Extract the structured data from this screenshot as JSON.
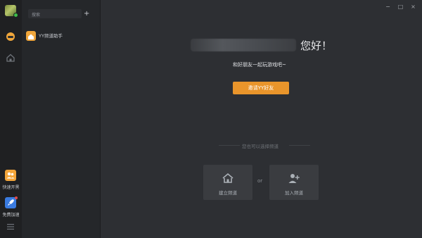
{
  "sidebar": {
    "quick_start_label": "快速开黑",
    "free_boost_label": "免费加速"
  },
  "panel": {
    "search_placeholder": "搜索",
    "add_symbol": "+",
    "channel_item": "YY频道助手"
  },
  "main": {
    "greeting": "您好！",
    "subtitle": "和好朋友一起玩游戏吧~",
    "invite_button": "邀请YY好友",
    "divider_text": "您也可以选择频道",
    "create_label": "建立频道",
    "or_label": "or",
    "join_label": "加入频道"
  },
  "window": {
    "minimize": "−",
    "maximize": "□",
    "close": "×"
  },
  "colors": {
    "accent": "#e9952b",
    "background": "#2d2f33"
  }
}
